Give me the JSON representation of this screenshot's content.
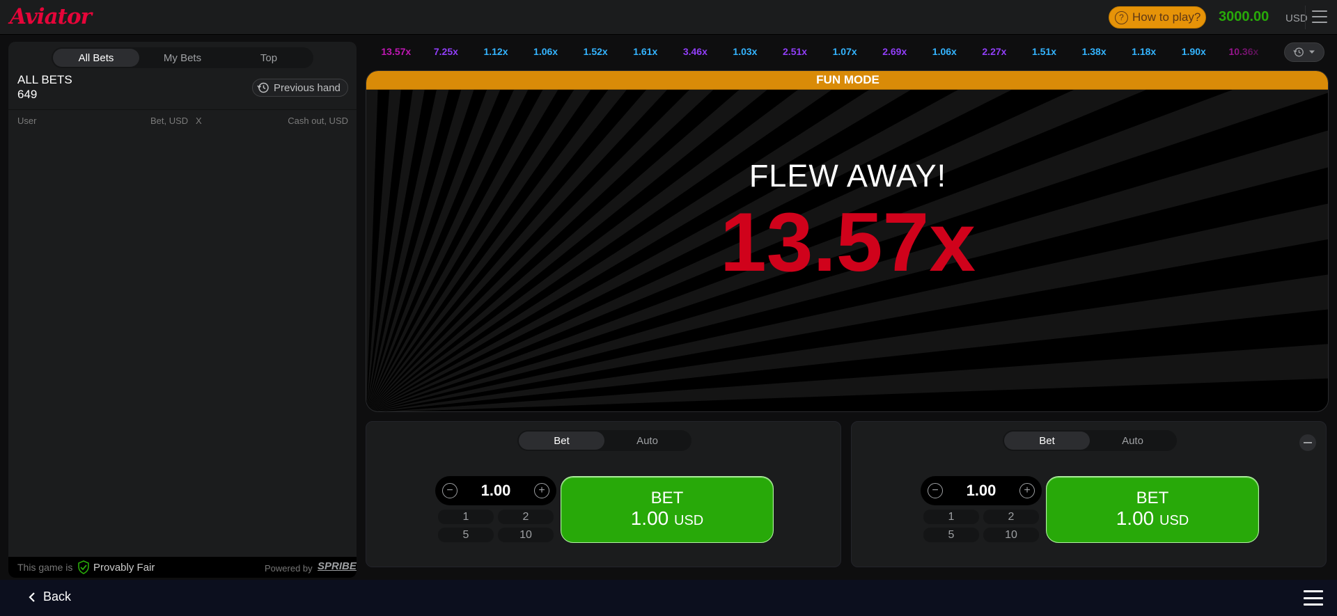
{
  "header": {
    "logo_text": "Aviator",
    "how_to_play_label": "How to play?",
    "balance_amount": "3000.00",
    "balance_currency": "USD"
  },
  "bets_panel": {
    "tabs": [
      {
        "label": "All Bets",
        "active": true
      },
      {
        "label": "My Bets",
        "active": false
      },
      {
        "label": "Top",
        "active": false
      }
    ],
    "title": "ALL BETS",
    "count": "649",
    "previous_hand_label": "Previous hand",
    "columns": {
      "user": "User",
      "bet": "Bet, USD",
      "x": "X",
      "cashout": "Cash out, USD"
    },
    "footer": {
      "fair_text": "This game is",
      "fair_label": "Provably Fair",
      "powered_by": "Powered by",
      "brand": "SPRIBE"
    }
  },
  "history": [
    {
      "value": "13.57x",
      "tier": "pink"
    },
    {
      "value": "7.25x",
      "tier": "purple"
    },
    {
      "value": "1.12x",
      "tier": "blue"
    },
    {
      "value": "1.06x",
      "tier": "blue"
    },
    {
      "value": "1.52x",
      "tier": "blue"
    },
    {
      "value": "1.61x",
      "tier": "blue"
    },
    {
      "value": "3.46x",
      "tier": "purple"
    },
    {
      "value": "1.03x",
      "tier": "blue"
    },
    {
      "value": "2.51x",
      "tier": "purple"
    },
    {
      "value": "1.07x",
      "tier": "blue"
    },
    {
      "value": "2.69x",
      "tier": "purple"
    },
    {
      "value": "1.06x",
      "tier": "blue"
    },
    {
      "value": "2.27x",
      "tier": "purple"
    },
    {
      "value": "1.51x",
      "tier": "blue"
    },
    {
      "value": "1.38x",
      "tier": "blue"
    },
    {
      "value": "1.18x",
      "tier": "blue"
    },
    {
      "value": "1.90x",
      "tier": "blue"
    },
    {
      "value": "10.36x",
      "tier": "pink"
    }
  ],
  "stage": {
    "banner": "FUN MODE",
    "status": "FLEW AWAY!",
    "multiplier": "13.57x"
  },
  "bet_panels": [
    {
      "tabs": [
        {
          "label": "Bet",
          "active": true
        },
        {
          "label": "Auto",
          "active": false
        }
      ],
      "amount": "1.00",
      "quick_amounts": [
        "1",
        "2",
        "5",
        "10"
      ],
      "button_label": "BET",
      "button_amount": "1.00",
      "button_currency": "USD"
    },
    {
      "tabs": [
        {
          "label": "Bet",
          "active": true
        },
        {
          "label": "Auto",
          "active": false
        }
      ],
      "amount": "1.00",
      "quick_amounts": [
        "1",
        "2",
        "5",
        "10"
      ],
      "button_label": "BET",
      "button_amount": "1.00",
      "button_currency": "USD"
    }
  ],
  "footer": {
    "back_label": "Back"
  },
  "colors": {
    "accent_red": "#e50539",
    "green": "#28a909",
    "orange": "#e69308",
    "mult_blue": "#34b4ff",
    "mult_purple": "#913ef8",
    "mult_pink": "#c017b4"
  }
}
